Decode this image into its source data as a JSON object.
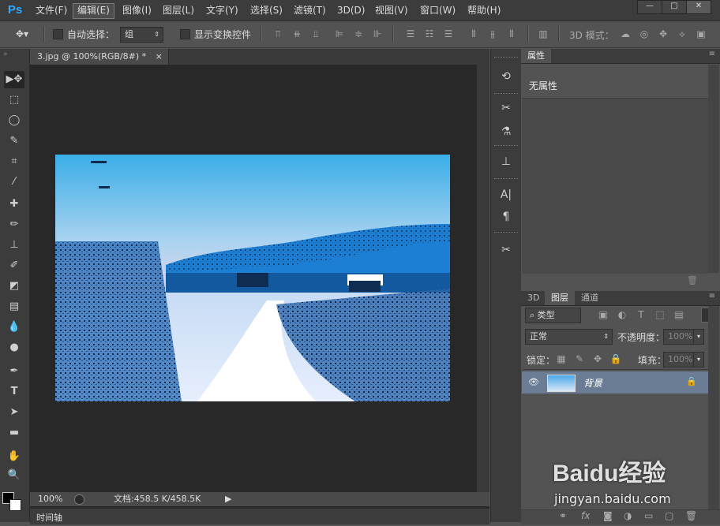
{
  "app": {
    "logo": "Ps"
  },
  "menu": {
    "items": [
      "文件(F)",
      "编辑(E)",
      "图像(I)",
      "图层(L)",
      "文字(Y)",
      "选择(S)",
      "滤镜(T)",
      "3D(D)",
      "视图(V)",
      "窗口(W)",
      "帮助(H)"
    ]
  },
  "window_controls": {
    "minimize": "—",
    "maximize": "□",
    "close": "✕"
  },
  "options": {
    "auto_select_label": "自动选择：",
    "auto_select_value": "组",
    "show_transform_label": "显示变换控件",
    "mode_3d_label": "3D 模式："
  },
  "document": {
    "tab_title": "3.jpg @ 100%(RGB/8#) *",
    "tab_close": "×",
    "zoom": "100%",
    "doc_info": "文档:458.5 K/458.5K"
  },
  "timeline": {
    "label": "时间轴"
  },
  "properties_panel": {
    "tab": "属性",
    "empty_text": "无属性"
  },
  "layers_panel": {
    "tabs": [
      "3D",
      "图层",
      "通道"
    ],
    "active_tab": "图层",
    "filter_label": "类型",
    "blend_mode": "正常",
    "opacity_label": "不透明度：",
    "opacity_value": "100%",
    "lock_label": "锁定：",
    "fill_label": "填充：",
    "fill_value": "100%",
    "layers": [
      {
        "name": "背景",
        "locked": true,
        "visible": true
      }
    ]
  },
  "icons": {
    "tools": [
      "move-icon",
      "marquee-icon",
      "lasso-icon",
      "quick-select-icon",
      "crop-icon",
      "eyedropper-icon",
      "healing-icon",
      "brush-icon",
      "stamp-icon",
      "history-brush-icon",
      "eraser-icon",
      "gradient-icon",
      "blur-icon",
      "dodge-icon",
      "pen-icon",
      "type-icon",
      "path-select-icon",
      "shape-icon",
      "hand-icon",
      "zoom-icon"
    ]
  },
  "watermark": {
    "brand": "Baidu经验",
    "url": "jingyan.baidu.com"
  },
  "colors": {
    "accent": "#31a8ff",
    "selected_layer": "#6a7d95",
    "chrome": "#3c3c3c",
    "panel": "#535353",
    "canvas_bg": "#282828"
  }
}
